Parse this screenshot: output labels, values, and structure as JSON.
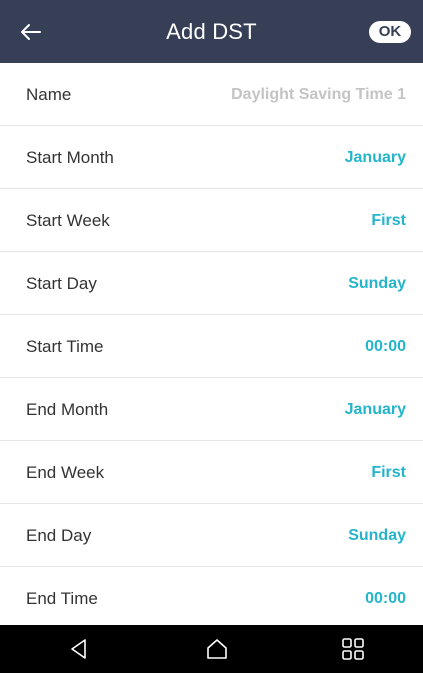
{
  "header": {
    "title": "Add DST",
    "ok_label": "OK",
    "back_icon": "arrow-left-icon"
  },
  "fields": [
    {
      "label": "Name",
      "value": "Daylight Saving Time 1",
      "is_placeholder": true
    },
    {
      "label": "Start Month",
      "value": "January"
    },
    {
      "label": "Start Week",
      "value": "First"
    },
    {
      "label": "Start Day",
      "value": "Sunday"
    },
    {
      "label": "Start Time",
      "value": "00:00"
    },
    {
      "label": "End Month",
      "value": "January"
    },
    {
      "label": "End Week",
      "value": "First"
    },
    {
      "label": "End Day",
      "value": "Sunday"
    },
    {
      "label": "End Time",
      "value": "00:00"
    }
  ],
  "navbar": {
    "back_icon": "triangle-back-icon",
    "home_icon": "home-icon",
    "recents_icon": "recents-icon"
  },
  "colors": {
    "header_bg": "#363f55",
    "accent": "#25b5cb",
    "placeholder": "#c4c4c4",
    "navbar_bg": "#000000"
  }
}
